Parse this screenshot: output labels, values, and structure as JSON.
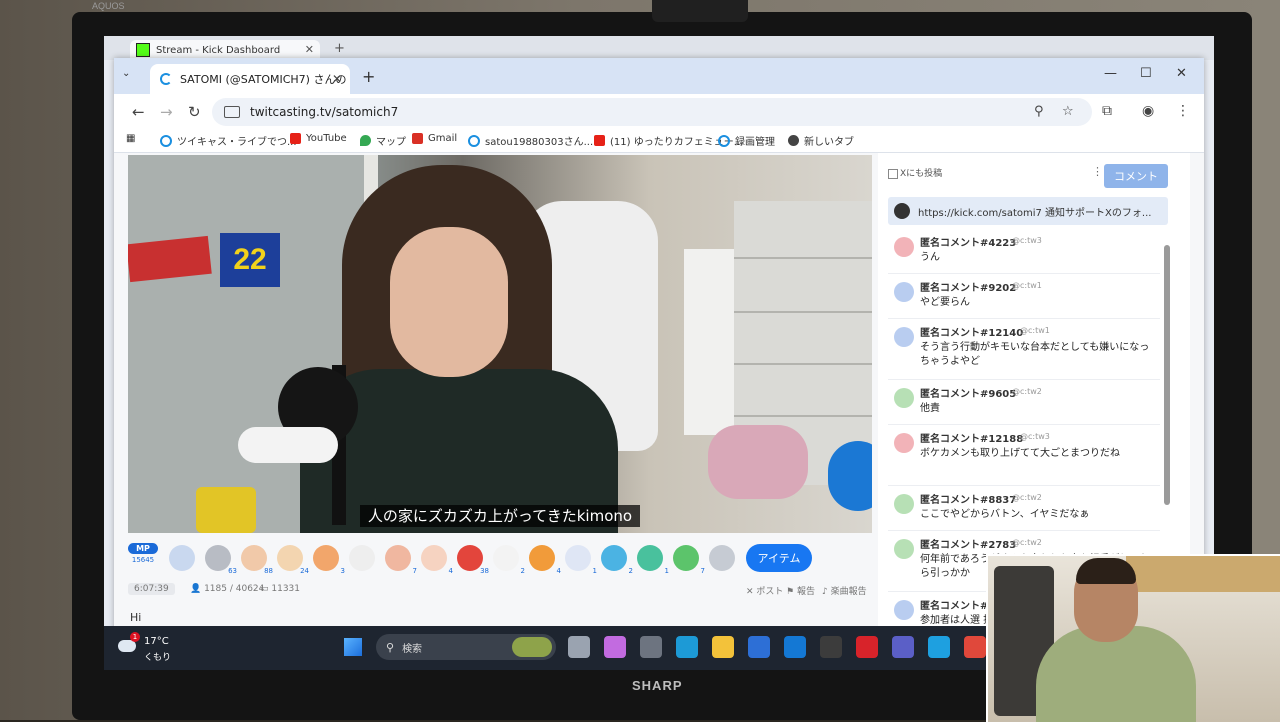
{
  "monitor": {
    "brand": "SHARP",
    "brand_top": "AQUOS"
  },
  "back_window": {
    "tab_title": "Stream - Kick Dashboard"
  },
  "browser": {
    "tab_title": "SATOMI (@SATOMICH7) さんの",
    "url": "twitcasting.tv/satomich7",
    "icons": [
      "back-icon",
      "forward-icon",
      "reload-icon",
      "zoom-icon",
      "star-icon",
      "extensions-icon",
      "profile-icon",
      "menu-icon"
    ]
  },
  "bookmarks": [
    {
      "label": "ツイキャス・ライブでつ...",
      "color": "#1a8fe0"
    },
    {
      "label": "YouTube",
      "color": "#e62117"
    },
    {
      "label": "マップ",
      "color": "#34a853"
    },
    {
      "label": "Gmail",
      "color": "#d93025"
    },
    {
      "label": "satou19880303さん...",
      "color": "#1a8fe0"
    },
    {
      "label": "(11) ゆったりカフェミュー...",
      "color": "#e62117"
    },
    {
      "label": "録画管理",
      "color": "#1a8fe0"
    },
    {
      "label": "新しいタブ",
      "color": "#444444"
    }
  ],
  "video": {
    "subtitle": "人の家にズカズカ上がってきたkimono",
    "sticker_number": "22"
  },
  "giftbar": {
    "mp_label": "MP",
    "mp_count": "15645",
    "gifts": [
      {
        "color": "#c9d8ef",
        "count": ""
      },
      {
        "color": "#b8bcc4",
        "count": "63"
      },
      {
        "color": "#f1c9a9",
        "count": "88"
      },
      {
        "color": "#f3d5b0",
        "count": "24"
      },
      {
        "color": "#f2a66b",
        "count": "3"
      },
      {
        "color": "#eeeeee",
        "count": ""
      },
      {
        "color": "#f0b7a0",
        "count": "7"
      },
      {
        "color": "#f6d3c1",
        "count": "4"
      },
      {
        "color": "#e3453c",
        "count": "38"
      },
      {
        "color": "#f3f3f3",
        "count": "2"
      },
      {
        "color": "#f19b3a",
        "count": "4"
      },
      {
        "color": "#dfe6f5",
        "count": "1"
      },
      {
        "color": "#4bb3e3",
        "count": "2"
      },
      {
        "color": "#49c19d",
        "count": "1"
      },
      {
        "color": "#5cc46b",
        "count": "7"
      },
      {
        "color": "#c6cbd3",
        "count": ""
      }
    ],
    "item_button": "アイテム"
  },
  "stats": {
    "time": "6:07:39",
    "viewers": "1185 / 40624",
    "comments": "11331",
    "post": "ポスト",
    "report": "報告",
    "song_report": "楽曲報告"
  },
  "comment_input_first_line": "Hi",
  "chat": {
    "x_checkbox_label": "Xにも投稿",
    "comment_button": "コメント",
    "pinned": "https://kick.com/satomi7 通知サポートXのフォ...",
    "comments": [
      {
        "name": "匿名コメント#4223",
        "id": "@c:tw3",
        "text": "うん",
        "avatar": "#f2b3b8"
      },
      {
        "name": "匿名コメント#9202",
        "id": "@c:tw1",
        "text": "やど要らん",
        "avatar": "#b9cdf0"
      },
      {
        "name": "匿名コメント#12140",
        "id": "@c:tw1",
        "text": "そう言う行動がキモいな台本だとしても嫌いになっちゃうよやど",
        "avatar": "#b9cdf0"
      },
      {
        "name": "匿名コメント#9605",
        "id": "@c:tw2",
        "text": "他責",
        "avatar": "#b7e0b5"
      },
      {
        "name": "匿名コメント#12188",
        "id": "@c:tw3",
        "text": "ボケカメンも取り上げてて大ごとまつりだね",
        "avatar": "#f2b3b8"
      },
      {
        "name": "匿名コメント#8837",
        "id": "@c:tw2",
        "text": "ここでやどからバトン、イヤミだなぁ",
        "avatar": "#b7e0b5"
      },
      {
        "name": "匿名コメント#2783",
        "id": "@c:tw2",
        "text": "何年前であろうがすんな言われた事を相手がしてたら引っかか",
        "avatar": "#b7e0b5"
      },
      {
        "name": "匿名コメント#",
        "id": "",
        "text": "参加者は人選 技術事が起こ",
        "avatar": "#b9cdf0"
      }
    ]
  },
  "taskbar": {
    "notification_count": "1",
    "temperature": "17°C",
    "condition": "くもり",
    "search_placeholder": "検索",
    "apps": [
      {
        "name": "task-view-icon",
        "color": "#9aa3b0"
      },
      {
        "name": "copilot-icon",
        "color": "#c26be0"
      },
      {
        "name": "app-icon",
        "color": "#6d7480"
      },
      {
        "name": "edge-icon",
        "color": "#1d9ad6"
      },
      {
        "name": "explorer-icon",
        "color": "#f3c23a"
      },
      {
        "name": "store-icon",
        "color": "#2d6fd6"
      },
      {
        "name": "outlook-icon",
        "color": "#1478d4"
      },
      {
        "name": "obs-icon",
        "color": "#3c3c3c"
      },
      {
        "name": "onair-icon",
        "color": "#d8232a"
      },
      {
        "name": "teams-icon",
        "color": "#5b5fc7"
      },
      {
        "name": "app2-icon",
        "color": "#1ea0e0"
      },
      {
        "name": "chrome-icon",
        "color": "#e0483b"
      }
    ]
  }
}
